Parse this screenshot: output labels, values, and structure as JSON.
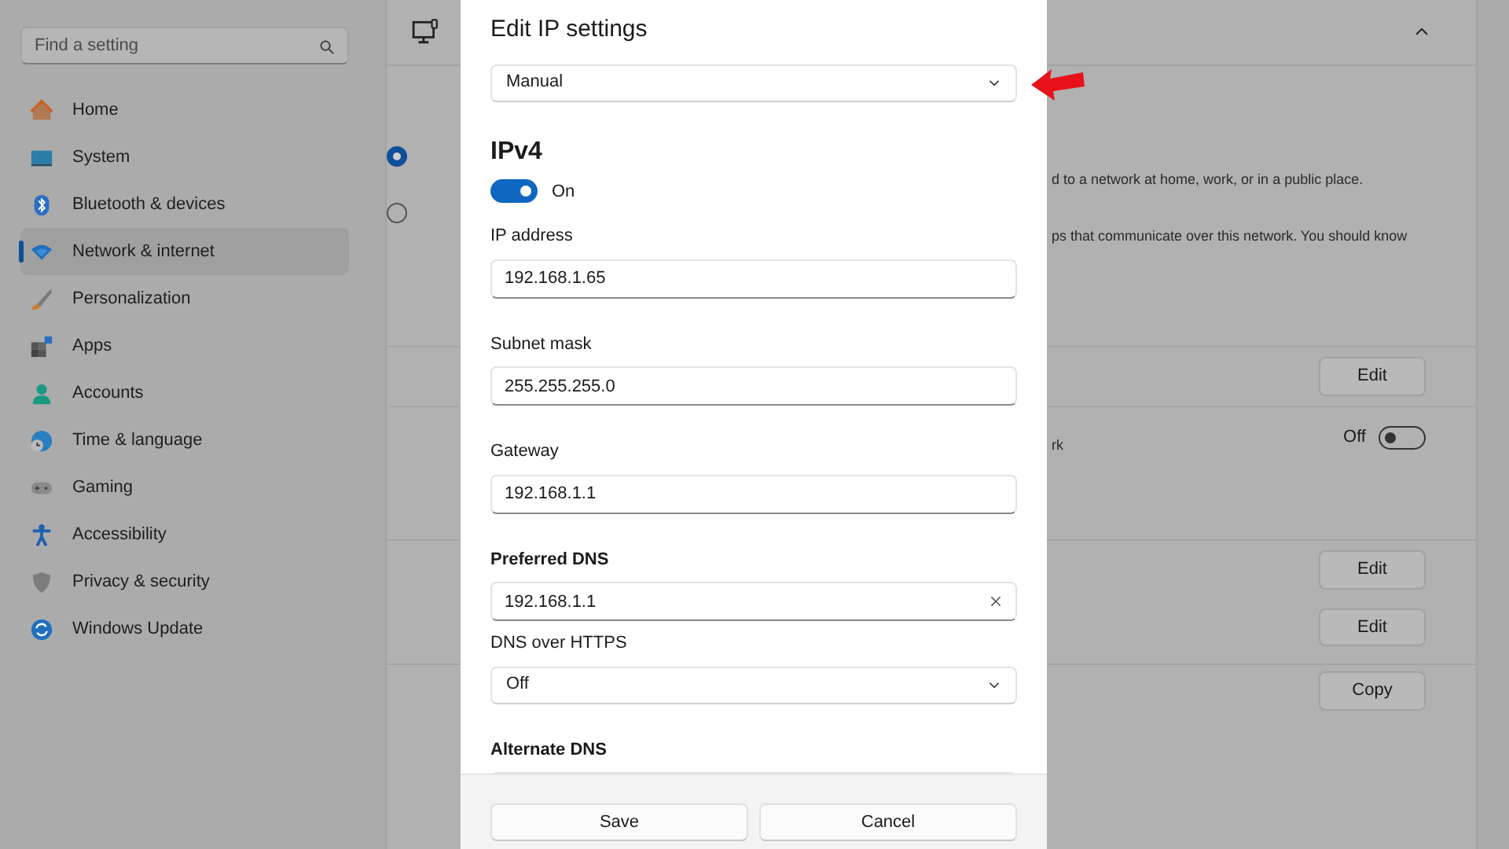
{
  "sidebar": {
    "search": {
      "placeholder": "Find a setting"
    },
    "items": [
      {
        "label": "Home",
        "selected": false
      },
      {
        "label": "System",
        "selected": false
      },
      {
        "label": "Bluetooth & devices",
        "selected": false
      },
      {
        "label": "Network & internet",
        "selected": true
      },
      {
        "label": "Personalization",
        "selected": false
      },
      {
        "label": "Apps",
        "selected": false
      },
      {
        "label": "Accounts",
        "selected": false
      },
      {
        "label": "Time & language",
        "selected": false
      },
      {
        "label": "Gaming",
        "selected": false
      },
      {
        "label": "Accessibility",
        "selected": false
      },
      {
        "label": "Privacy & security",
        "selected": false
      },
      {
        "label": "Windows Update",
        "selected": false
      }
    ]
  },
  "background": {
    "header": {
      "expanded": true
    },
    "rows": [
      {
        "kind": "radio",
        "checked": true,
        "note": "d to a network at home, work, or in a public place."
      },
      {
        "kind": "radio",
        "checked": false,
        "note": "ps that communicate over this network. You should know"
      },
      {
        "kind": "setting",
        "button": "Edit"
      },
      {
        "kind": "setting",
        "note": "rk",
        "toggle": {
          "on": false,
          "label": "Off"
        }
      },
      {
        "kind": "setting",
        "button": "Edit"
      },
      {
        "kind": "setting",
        "button": "Edit"
      },
      {
        "kind": "setting",
        "button": "Copy"
      }
    ]
  },
  "dialog": {
    "title": "Edit IP settings",
    "mode": {
      "value": "Manual"
    },
    "section": "IPv4",
    "toggle": {
      "on": true,
      "label": "On"
    },
    "fields": [
      {
        "kind": "text",
        "label": "IP address",
        "bold": false,
        "value": "192.168.1.65",
        "clear": false
      },
      {
        "kind": "text",
        "label": "Subnet mask",
        "bold": false,
        "value": "255.255.255.0",
        "clear": false
      },
      {
        "kind": "text",
        "label": "Gateway",
        "bold": false,
        "value": "192.168.1.1",
        "clear": false
      },
      {
        "kind": "text",
        "label": "Preferred DNS",
        "bold": true,
        "value": "192.168.1.1",
        "clear": true
      },
      {
        "kind": "select",
        "label": "DNS over HTTPS",
        "bold": false,
        "value": "Off"
      },
      {
        "kind": "text",
        "label": "Alternate DNS",
        "bold": true,
        "clear": false
      }
    ],
    "buttons": [
      "Save",
      "Cancel"
    ]
  }
}
